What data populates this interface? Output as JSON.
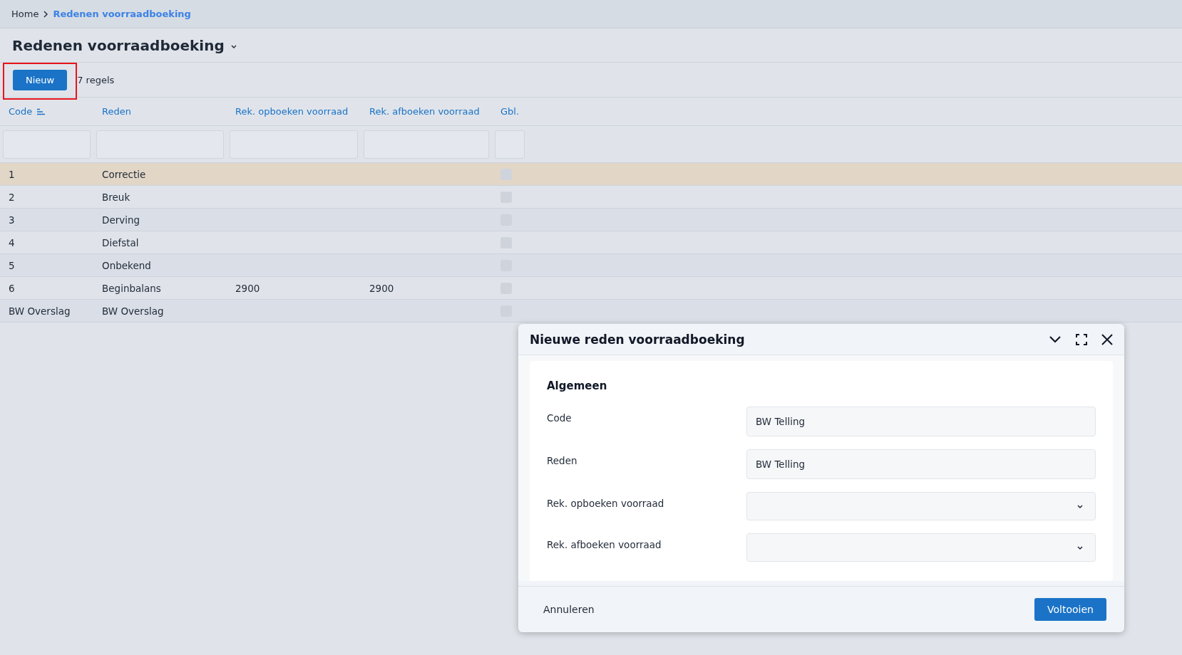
{
  "breadcrumb": [
    {
      "label": "Home",
      "current": false
    },
    {
      "label": "Redenen voorraadboeking",
      "current": true
    }
  ],
  "page_title": "Redenen voorraadboeking",
  "toolbar": {
    "new_button": {
      "label": "Nieuw",
      "highlighted": true
    },
    "row_count": "7 regels"
  },
  "table": {
    "columns": [
      {
        "label": "Code",
        "sorted": true
      },
      {
        "label": "Reden",
        "sorted": false
      },
      {
        "label": "Rek. opboeken voorraad",
        "sorted": false
      },
      {
        "label": "Rek. afboeken voorraad",
        "sorted": false
      },
      {
        "label": "Gbl.",
        "sorted": false
      }
    ],
    "rows": [
      {
        "code": "1",
        "reden": "Correctie",
        "gbl": false,
        "selected": true
      },
      {
        "code": "2",
        "reden": "Breuk",
        "gbl": false,
        "selected": false
      },
      {
        "code": "3",
        "reden": "Derving",
        "gbl": false,
        "selected": false
      },
      {
        "code": "4",
        "reden": "Diefstal",
        "gbl": false,
        "selected": false
      },
      {
        "code": "5",
        "reden": "Onbekend",
        "gbl": false,
        "selected": false
      },
      {
        "code": "6",
        "reden": "Beginbalans",
        "opboeken": "2900",
        "afboeken": "2900",
        "gbl": false,
        "selected": false
      },
      {
        "code": "BW Overslag",
        "reden": "BW Overslag",
        "gbl": false,
        "selected": false
      }
    ]
  },
  "dialog": {
    "title": "Nieuwe reden voorraadboeking",
    "section": "Algemeen",
    "fields": [
      {
        "label": "Code",
        "kind": "text",
        "value": "BW Telling"
      },
      {
        "label": "Reden",
        "kind": "text",
        "value": "BW Telling"
      },
      {
        "label": "Rek. opboeken voorraad",
        "kind": "select"
      },
      {
        "label": "Rek. afboeken voorraad",
        "kind": "select"
      }
    ],
    "cancel": "Annuleren",
    "confirm": "Voltooien"
  }
}
